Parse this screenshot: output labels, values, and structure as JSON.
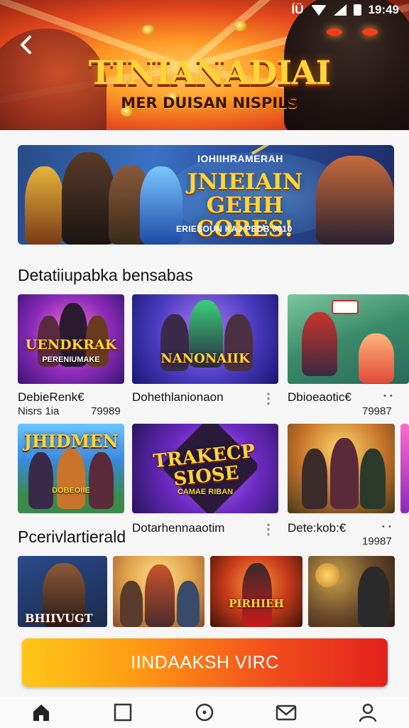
{
  "status_bar": {
    "left_glyph": "ÍÜ",
    "time": "19:49",
    "icons": [
      "wifi-icon",
      "signal-icon",
      "battery-icon"
    ]
  },
  "hero": {
    "title": "TINIANADIAI",
    "subtitle": "MER DUISAN NISPILS",
    "back_icon": "back-arrow-icon"
  },
  "promo": {
    "kicker": "IOHIIHRAMERAH",
    "headline_line1": "JNIEIAIN GEHH",
    "headline_line2": "CORES!",
    "footer": "ERIESOUN KAJ PEDB 0010"
  },
  "section1": {
    "title": "Detatiiupabka bensabas",
    "games": [
      {
        "badge": "UENDKRAK",
        "sub_badge": "PERENIUMAKE",
        "name": "DebieRenk€",
        "meta": "Nisrs 1ia",
        "count": "79989"
      },
      {
        "badge": "NANONAIIK",
        "sub_badge": "",
        "name": "Dohethlanionaon",
        "meta": "",
        "count": ""
      },
      {
        "badge": "",
        "sub_badge": "",
        "name": "Dbioeaotic€",
        "meta": "",
        "count": "79987"
      }
    ],
    "games_row2": [
      {
        "badge": "JHIDMEN",
        "sub_badge": "DOBEOIIE",
        "name": "",
        "meta": "",
        "count": ""
      },
      {
        "badge": "TRAKECP SIOSE",
        "sub_badge": "CAMAE RIBAN",
        "name": "Dotarhennaaotim",
        "meta": "",
        "count": ""
      },
      {
        "badge": "",
        "sub_badge": "",
        "name": "Dete:kob:€",
        "meta": "",
        "count": "19987"
      }
    ]
  },
  "section2": {
    "title": "Pcerivlartierald",
    "tiles": [
      {
        "badge": "BHIIVUGT"
      },
      {
        "badge": ""
      },
      {
        "badge": "PIRHIEH"
      },
      {
        "badge": ""
      }
    ]
  },
  "cta": {
    "label": "IINDAAKSH VIRC"
  },
  "bottom_nav": [
    {
      "icon": "home-icon",
      "active": true
    },
    {
      "icon": "square-icon",
      "active": false
    },
    {
      "icon": "circle-dot-icon",
      "active": false
    },
    {
      "icon": "mail-icon",
      "active": false
    },
    {
      "icon": "profile-icon",
      "active": false
    }
  ],
  "colors": {
    "cta_start": "#ffc619",
    "cta_end": "#e2211c",
    "hero_orange": "#ff9a26",
    "title_gold": "#ffd43a"
  }
}
